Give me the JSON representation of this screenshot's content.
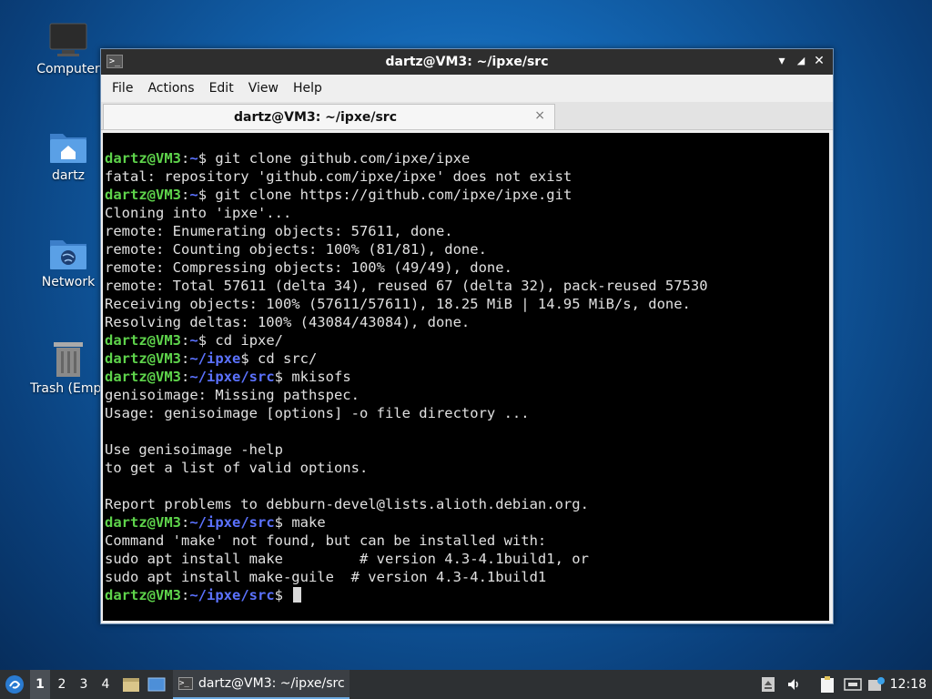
{
  "desktop": {
    "icons": [
      {
        "label": "Computer",
        "icon": "monitor-icon"
      },
      {
        "label": "dartz",
        "icon": "home-folder-icon"
      },
      {
        "label": "Network",
        "icon": "network-folder-icon"
      },
      {
        "label": "Trash (Empt",
        "icon": "trash-icon"
      }
    ]
  },
  "window": {
    "title": "dartz@VM3: ~/ipxe/src",
    "menu": [
      "File",
      "Actions",
      "Edit",
      "View",
      "Help"
    ],
    "tab": {
      "label": "dartz@VM3: ~/ipxe/src",
      "close": "×"
    },
    "buttons": {
      "minimize": "▾",
      "maximize": "◢",
      "close": "✕"
    }
  },
  "terminal": {
    "lines": [
      {
        "user": "dartz@VM3",
        "sep": ":",
        "path": "~",
        "sym": "$",
        "cmd": " git clone github.com/ipxe/ipxe"
      },
      {
        "text": "fatal: repository 'github.com/ipxe/ipxe' does not exist"
      },
      {
        "user": "dartz@VM3",
        "sep": ":",
        "path": "~",
        "sym": "$",
        "cmd": " git clone https://github.com/ipxe/ipxe.git"
      },
      {
        "text": "Cloning into 'ipxe'..."
      },
      {
        "text": "remote: Enumerating objects: 57611, done."
      },
      {
        "text": "remote: Counting objects: 100% (81/81), done."
      },
      {
        "text": "remote: Compressing objects: 100% (49/49), done."
      },
      {
        "text": "remote: Total 57611 (delta 34), reused 67 (delta 32), pack-reused 57530"
      },
      {
        "text": "Receiving objects: 100% (57611/57611), 18.25 MiB | 14.95 MiB/s, done."
      },
      {
        "text": "Resolving deltas: 100% (43084/43084), done."
      },
      {
        "user": "dartz@VM3",
        "sep": ":",
        "path": "~",
        "sym": "$",
        "cmd": " cd ipxe/"
      },
      {
        "user": "dartz@VM3",
        "sep": ":",
        "path": "~/ipxe",
        "sym": "$",
        "cmd": " cd src/"
      },
      {
        "user": "dartz@VM3",
        "sep": ":",
        "path": "~/ipxe/src",
        "sym": "$",
        "cmd": " mkisofs"
      },
      {
        "text": "genisoimage: Missing pathspec."
      },
      {
        "text": "Usage: genisoimage [options] -o file directory ..."
      },
      {
        "text": ""
      },
      {
        "text": "Use genisoimage -help"
      },
      {
        "text": "to get a list of valid options."
      },
      {
        "text": ""
      },
      {
        "text": "Report problems to debburn-devel@lists.alioth.debian.org."
      },
      {
        "user": "dartz@VM3",
        "sep": ":",
        "path": "~/ipxe/src",
        "sym": "$",
        "cmd": " make"
      },
      {
        "text": "Command 'make' not found, but can be installed with:"
      },
      {
        "text": "sudo apt install make         # version 4.3-4.1build1, or"
      },
      {
        "text": "sudo apt install make-guile  # version 4.3-4.1build1"
      },
      {
        "user": "dartz@VM3",
        "sep": ":",
        "path": "~/ipxe/src",
        "sym": "$",
        "cmd": " ",
        "cursor": true
      }
    ]
  },
  "taskbar": {
    "workspaces": [
      "1",
      "2",
      "3",
      "4"
    ],
    "active_workspace": "1",
    "task": {
      "label": "dartz@VM3: ~/ipxe/src"
    },
    "clock": "12:18"
  },
  "colors": {
    "prompt_user": "#5ed34b",
    "prompt_path": "#5b72ff",
    "terminal_bg": "#000000"
  }
}
